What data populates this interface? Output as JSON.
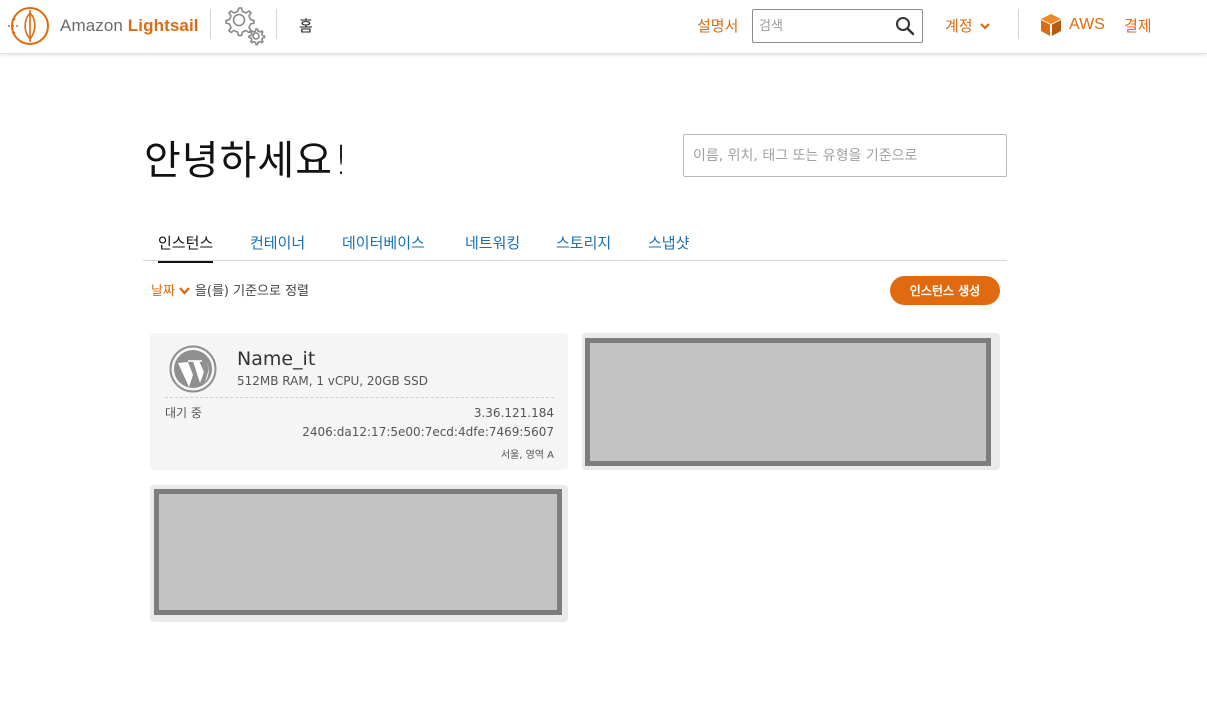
{
  "header": {
    "brand_prefix": "Amazon",
    "brand_name": "Lightsail",
    "home_label": "홈",
    "docs_label": "설명서",
    "search_placeholder": "검색",
    "account_label": "계정",
    "aws_label": "AWS",
    "billing_label": "결제"
  },
  "colors": {
    "accent": "#dd6b10",
    "link_blue": "#1a6fb3",
    "create_button": "#e06a10"
  },
  "main": {
    "greeting": "안녕하세요!",
    "filter_placeholder": "이름, 위치, 태그 또는 유형을 기준으로",
    "tabs": [
      {
        "label": "인스턴스",
        "active": true
      },
      {
        "label": "컨테이너",
        "active": false
      },
      {
        "label": "데이터베이스",
        "active": false
      },
      {
        "label": "네트워킹",
        "active": false
      },
      {
        "label": "스토리지",
        "active": false
      },
      {
        "label": "스냅샷",
        "active": false
      }
    ],
    "sort_key": "날짜",
    "sort_suffix": "을(를) 기준으로 정렬",
    "create_button": "인스턴스 생성"
  },
  "instances": [
    {
      "name": "Name_it",
      "spec": "512MB RAM, 1 vCPU, 20GB SSD",
      "state": "대기 중",
      "ipv4": "3.36.121.184",
      "ipv6": "2406:da12:17:5e00:7ecd:4dfe:7469:5607",
      "region": "서울, 영역 A",
      "icon": "wordpress-icon"
    }
  ]
}
